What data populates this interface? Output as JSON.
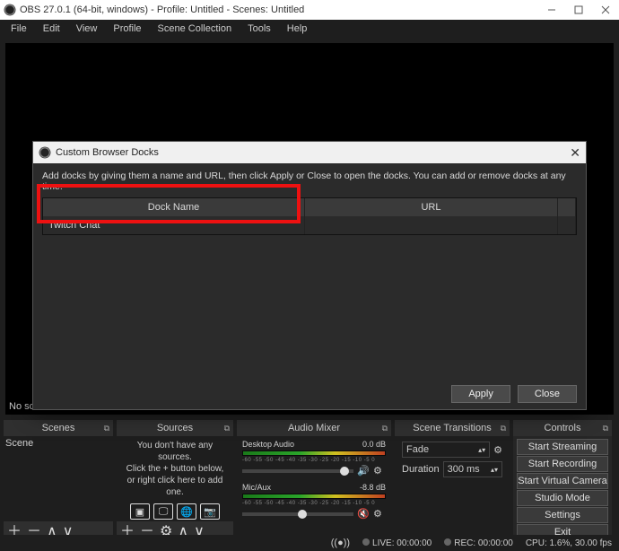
{
  "titlebar": {
    "text": "OBS 27.0.1 (64-bit, windows) - Profile: Untitled - Scenes: Untitled"
  },
  "menubar": [
    "File",
    "Edit",
    "View",
    "Profile",
    "Scene Collection",
    "Tools",
    "Help"
  ],
  "preview": {
    "no_source": "No sour"
  },
  "panels": {
    "scenes": {
      "title": "Scenes",
      "items": [
        "Scene"
      ]
    },
    "sources": {
      "title": "Sources",
      "hint_l1": "You don't have any sources.",
      "hint_l2": "Click the + button below,",
      "hint_l3": "or right click here to add one."
    },
    "mixer": {
      "title": "Audio Mixer",
      "channels": [
        {
          "name": "Desktop Audio",
          "db": "0.0 dB",
          "thumb_pct": 88,
          "muted": false
        },
        {
          "name": "Mic/Aux",
          "db": "-8.8 dB",
          "thumb_pct": 50,
          "muted": true
        }
      ],
      "ticks": "-60  -55  -50  -45  -40  -35  -30  -25  -20  -15  -10   -5    0"
    },
    "transitions": {
      "title": "Scene Transitions",
      "mode": "Fade",
      "duration_label": "Duration",
      "duration_value": "300 ms"
    },
    "controls": {
      "title": "Controls",
      "buttons": [
        "Start Streaming",
        "Start Recording",
        "Start Virtual Camera",
        "Studio Mode",
        "Settings",
        "Exit"
      ]
    }
  },
  "statusbar": {
    "live_label": "LIVE: 00:00:00",
    "rec_label": "REC: 00:00:00",
    "cpu": "CPU: 1.6%, 30.00 fps"
  },
  "dialog": {
    "title": "Custom Browser Docks",
    "hint": "Add docks by giving them a name and URL, then click Apply or Close to open the docks. You can add or remove docks at any time.",
    "col_name": "Dock Name",
    "col_url": "URL",
    "rows": [
      {
        "name": "Twitch Chat",
        "url": ""
      }
    ],
    "apply": "Apply",
    "close": "Close"
  }
}
